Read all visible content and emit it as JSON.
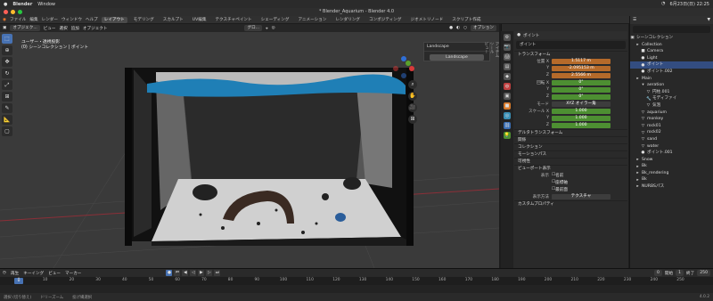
{
  "macos": {
    "app": "Blender",
    "menu": "Window",
    "clock": "6月23日(日) 22:25"
  },
  "window": {
    "title": "* Blender_Aquarium - Blender 4.0"
  },
  "menubar": {
    "items": [
      "ファイル",
      "編集",
      "レンダー",
      "ウィンドウ",
      "ヘルプ"
    ],
    "workspaces": [
      "レイアウト",
      "モデリング",
      "スカルプト",
      "UV編集",
      "テクスチャペイント",
      "シェーディング",
      "アニメーション",
      "レンダリング",
      "コンポジティング",
      "ジオメトリノード",
      "スクリプト作成"
    ],
    "active_workspace": "レイアウト",
    "scene": "Scene",
    "view_layer": "ViewLayer"
  },
  "viewport": {
    "mode": "オブジェク...",
    "menu": [
      "ビュー",
      "選択",
      "追加",
      "オブジェクト"
    ],
    "transform": "グロ...",
    "options": "オプション",
    "info_line1": "ユーザー・透視投影",
    "info_line2": "(0) シーンコレクション | ポイント",
    "n_panel_title": "Landscape",
    "n_panel_button": "Landscape",
    "n_tabs": [
      "アイテム",
      "ツール",
      "ビュー"
    ]
  },
  "properties": {
    "object_header": "ポイント",
    "object_name": "ポイント",
    "sections": {
      "transform": "トランスフォーム",
      "delta": "デルタトランスフォーム",
      "relations": "関係",
      "collections": "コレクション",
      "motion_paths": "モーションパス",
      "visibility": "可視性",
      "viewport_display": "ビューポート表示",
      "custom_props": "カスタムプロパティ"
    },
    "location_label": "位置 X",
    "location": [
      "1.5117 m",
      "-2.095153 m",
      "2.5566 m"
    ],
    "rotation_label": "回転 X",
    "rotation": [
      "0°",
      "0°",
      "0°"
    ],
    "mode_label": "モード",
    "mode_value": "XYZ オイラー角",
    "scale_label": "スケール X",
    "scale": [
      "1.000",
      "1.000",
      "1.000"
    ],
    "y_label": "Y",
    "z_label": "Z",
    "display_label": "表示",
    "display_options": [
      "名前",
      "座標軸",
      "最前面"
    ],
    "display_as_label": "表示方法",
    "display_as_value": "テクスチャ"
  },
  "outliner": {
    "root": "シーンコレクション",
    "items": [
      {
        "name": "Collection",
        "indent": 1,
        "icon": "▸"
      },
      {
        "name": "Camera",
        "indent": 2,
        "icon": "■"
      },
      {
        "name": "Light",
        "indent": 2,
        "icon": "●"
      },
      {
        "name": "ポイント",
        "indent": 2,
        "icon": "●"
      },
      {
        "name": "ポイント.002",
        "indent": 2,
        "icon": "●"
      },
      {
        "name": "Main",
        "indent": 1,
        "icon": "▸"
      },
      {
        "name": "aeration",
        "indent": 2,
        "icon": "▾"
      },
      {
        "name": "円柱.001",
        "indent": 3,
        "icon": "▽"
      },
      {
        "name": "モディファイ",
        "indent": 3,
        "icon": "🔧"
      },
      {
        "name": "気泡",
        "indent": 3,
        "icon": "▽"
      },
      {
        "name": "aquarium",
        "indent": 2,
        "icon": "▽"
      },
      {
        "name": "monkey",
        "indent": 2,
        "icon": "▽"
      },
      {
        "name": "rock01",
        "indent": 2,
        "icon": "▽"
      },
      {
        "name": "rock02",
        "indent": 2,
        "icon": "▽"
      },
      {
        "name": "sand",
        "indent": 2,
        "icon": "▽"
      },
      {
        "name": "water",
        "indent": 2,
        "icon": "▽"
      },
      {
        "name": "ポイント.001",
        "indent": 2,
        "icon": "●"
      },
      {
        "name": "Snow",
        "indent": 1,
        "icon": "▸"
      },
      {
        "name": "Bk",
        "indent": 1,
        "icon": "▸"
      },
      {
        "name": "Bk_rendering",
        "indent": 1,
        "icon": "▸"
      },
      {
        "name": "Bk",
        "indent": 1,
        "icon": "▸"
      },
      {
        "name": "NURBSパス",
        "indent": 1,
        "icon": "▸"
      }
    ]
  },
  "timeline": {
    "menu": [
      "再生",
      "キーイング",
      "ビュー",
      "マーカー"
    ],
    "current_frame": "0",
    "start_label": "開始",
    "start": "1",
    "end_label": "終了",
    "end": "250",
    "ticks": [
      0,
      10,
      20,
      30,
      40,
      50,
      60,
      70,
      80,
      90,
      100,
      110,
      120,
      130,
      140,
      150,
      160,
      170,
      180,
      190,
      200,
      210,
      220,
      230,
      240,
      250
    ]
  },
  "statusbar": {
    "items": [
      "選択 (切り替え)",
      "ドリーズーム",
      "投げ縄選択"
    ],
    "version": "4.0.2"
  },
  "colors": {
    "accent": "#4772b3",
    "location_field": "#b56a2a",
    "rotation_field": "#4d8f32",
    "water": "#1f7fb6"
  }
}
